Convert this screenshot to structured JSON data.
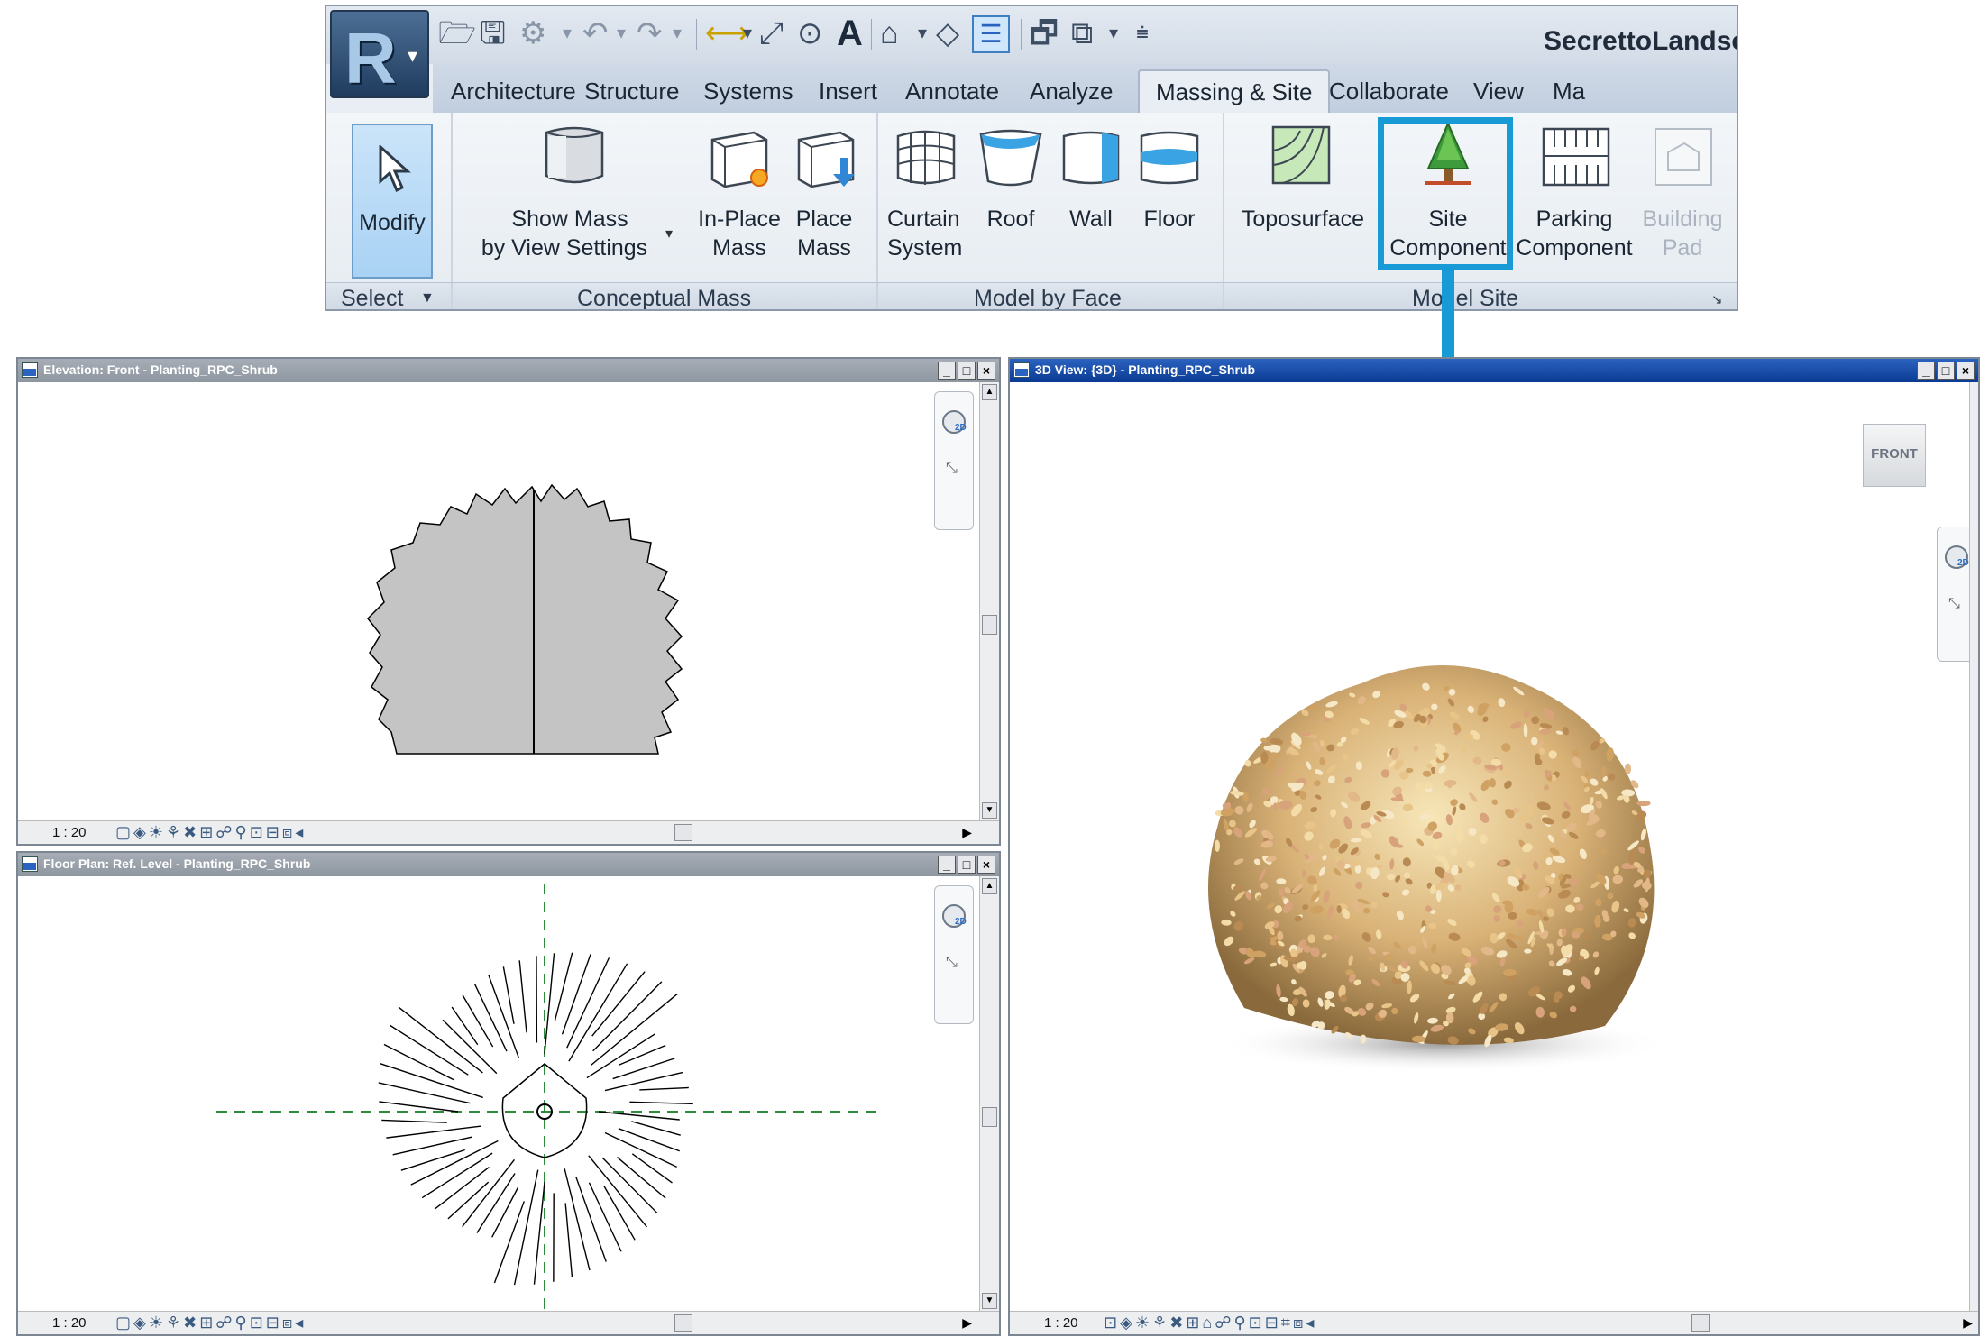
{
  "app": {
    "title": "SecrettoLandsca",
    "logo_letter": "R"
  },
  "tabs": [
    "Architecture",
    "Structure",
    "Systems",
    "Insert",
    "Annotate",
    "Analyze",
    "Massing & Site",
    "Collaborate",
    "View",
    "Ma"
  ],
  "active_tab": "Massing & Site",
  "buttons": {
    "modify": "Modify",
    "show_mass_1": "Show Mass",
    "show_mass_2": "by View Settings",
    "inplace_1": "In-Place",
    "inplace_2": "Mass",
    "place_1": "Place",
    "place_2": "Mass",
    "curtain_1": "Curtain",
    "curtain_2": "System",
    "roof": "Roof",
    "wall": "Wall",
    "floor": "Floor",
    "toposurface": "Toposurface",
    "site_1": "Site",
    "site_2": "Component",
    "parking_1": "Parking",
    "parking_2": "Component",
    "building_1": "Building",
    "building_2": "Pad"
  },
  "panels": {
    "select": "Select",
    "conceptual_mass": "Conceptual Mass",
    "model_by_face": "Model by Face",
    "model_site": "Model Site"
  },
  "views": {
    "elevation": {
      "title": "Elevation: Front - Planting_RPC_Shrub",
      "scale": "1 : 20"
    },
    "floor_plan": {
      "title": "Floor Plan: Ref. Level - Planting_RPC_Shrub",
      "scale": "1 : 20"
    },
    "view3d": {
      "title": "3D View: {3D} - Planting_RPC_Shrub",
      "scale": "1 : 20",
      "viewcube_label": "FRONT"
    }
  },
  "colors": {
    "highlight": "#179ad6",
    "active_titlebar": "#0a3a92"
  }
}
